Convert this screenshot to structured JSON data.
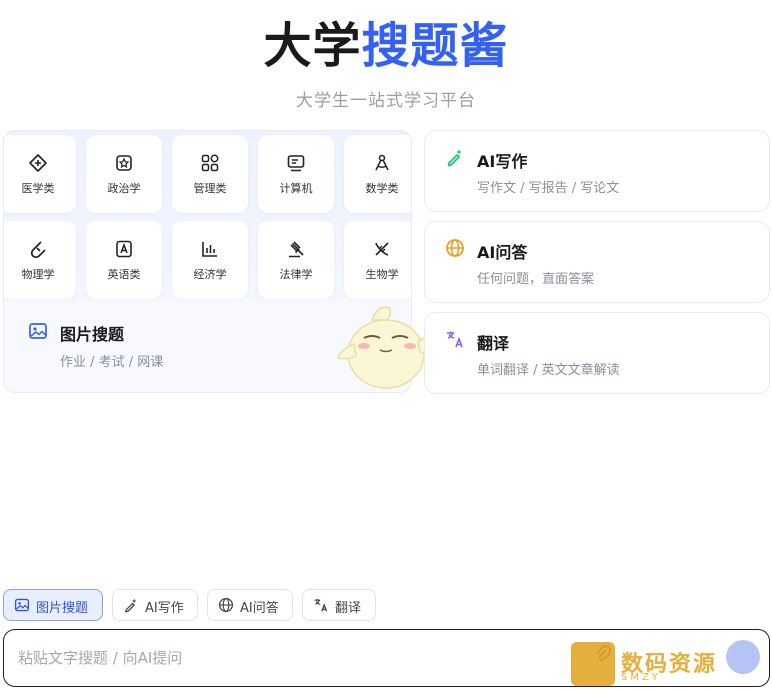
{
  "header": {
    "title_part1": "大学",
    "title_part2": "搜题酱",
    "subtitle": "大学生一站式学习平台"
  },
  "subjects": [
    {
      "label": "医学类",
      "icon": "medical-icon"
    },
    {
      "label": "政治学",
      "icon": "politics-icon"
    },
    {
      "label": "管理类",
      "icon": "management-icon"
    },
    {
      "label": "计算机",
      "icon": "computer-icon"
    },
    {
      "label": "数学类",
      "icon": "math-icon"
    },
    {
      "label": "物理学",
      "icon": "physics-icon"
    },
    {
      "label": "英语类",
      "icon": "english-icon"
    },
    {
      "label": "经济学",
      "icon": "economics-icon"
    },
    {
      "label": "法律学",
      "icon": "law-icon"
    },
    {
      "label": "生物学",
      "icon": "biology-icon"
    }
  ],
  "photo_search": {
    "title": "图片搜题",
    "desc": "作业 / 考试 / 网课"
  },
  "right_cards": [
    {
      "title": "AI写作",
      "desc": "写作文 / 写报告 / 写论文",
      "icon": "ai-write-icon",
      "color": "#1fbf7a"
    },
    {
      "title": "AI问答",
      "desc": "任何问题，直面答案",
      "icon": "globe-icon",
      "color": "#f29a1a"
    },
    {
      "title": "翻译",
      "desc": "单词翻译 / 英文文章解读",
      "icon": "translate-icon",
      "color": "#8b5cf6"
    }
  ],
  "tools": [
    {
      "label": "图片搜题",
      "active": true
    },
    {
      "label": "AI写作",
      "active": false
    },
    {
      "label": "AI问答",
      "active": false
    },
    {
      "label": "翻译",
      "active": false
    }
  ],
  "input": {
    "placeholder": "粘贴文字搜题 / 向AI提问"
  },
  "watermark": {
    "text": "数码资源",
    "sub": "SMZY"
  },
  "colors": {
    "accent": "#3360f5",
    "active_chip_bg": "#e9eefc"
  }
}
